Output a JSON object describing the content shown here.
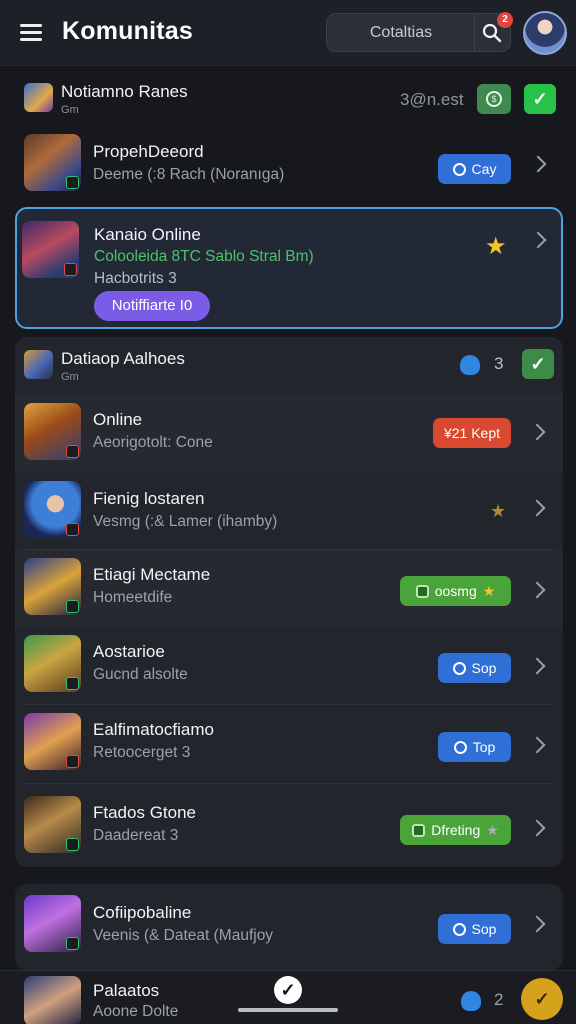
{
  "header": {
    "title": "Komunitas",
    "search_text": "Cotaltias",
    "notification_count": "2"
  },
  "top_row": {
    "title": "Notiamno Ranes",
    "subtitle": "Gm",
    "right_text": "3@n.est"
  },
  "first_group": {
    "items": [
      {
        "title": "PropehDeeord",
        "subtitle": "Deeme (:8 Rach (Noranıga)",
        "button": "Cay"
      }
    ]
  },
  "highlight_item": {
    "title": "Kanaio Online",
    "subtitle": "Colooleida 8TC Sablo Stral Bm)",
    "meta": "Hacbotrits 3",
    "pill": "Notiffiarte I0"
  },
  "second_group": {
    "header_title": "Datiaop Aalhoes",
    "header_sub": "Gm",
    "header_count": "3",
    "items": [
      {
        "title": "Online",
        "subtitle": "Aeorigotolt: Cone",
        "button": "¥21 Kept",
        "button_style": "orange"
      },
      {
        "title": "Fienig lostaren",
        "subtitle": "Vesmg (:& Lamer (ihamby)",
        "button": "",
        "button_style": "star"
      },
      {
        "title": "Etiagi Mectame",
        "subtitle": "Homeetdife",
        "button": "oosmg",
        "button_style": "green"
      },
      {
        "title": "Aostarioe",
        "subtitle": "Gucnd alsolte",
        "button": "Sop",
        "button_style": "blue"
      },
      {
        "title": "Ealfimatocfiamo",
        "subtitle": "Retoocerget 3",
        "button": "Top",
        "button_style": "blue"
      },
      {
        "title": "Ftados Gtone",
        "subtitle": "Daadereat 3",
        "button": "Dfreting",
        "button_style": "green"
      }
    ]
  },
  "third_group": {
    "items": [
      {
        "title": "Cofiipobaline",
        "subtitle": "Veenis (& Dateat (Maufjoy",
        "button": "Sop"
      }
    ]
  },
  "bottom": {
    "title": "Palaatos",
    "subtitle": "Aoone Dolte",
    "count": "2"
  },
  "colors": {
    "accent_blue": "#2f6fd6",
    "accent_green": "#4aa43a",
    "accent_orange": "#d9492f",
    "highlight_border": "#4aa3e0",
    "purple": "#7b5ce6"
  }
}
